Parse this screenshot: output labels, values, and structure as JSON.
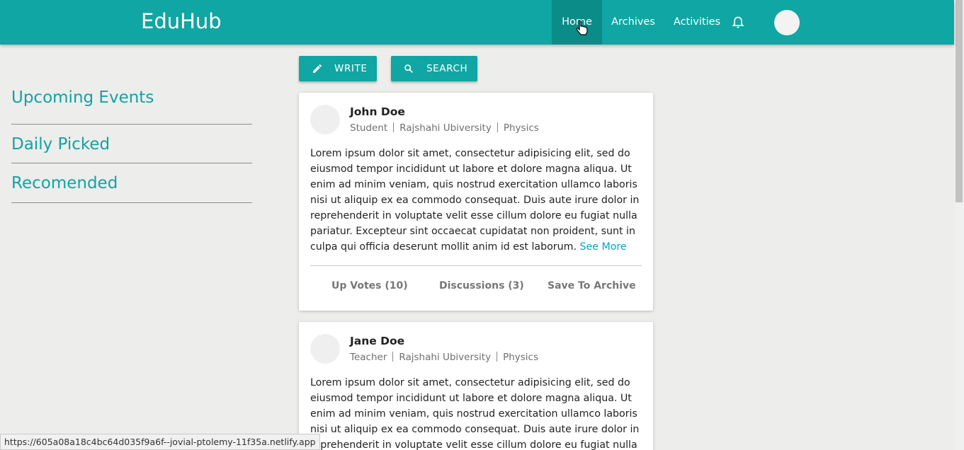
{
  "header": {
    "brand": "EduHub",
    "nav": [
      {
        "label": "Home"
      },
      {
        "label": "Archives"
      },
      {
        "label": "Activities"
      }
    ],
    "bell_icon": "bell-icon",
    "accent_color": "#0fa6a3"
  },
  "sidebar": {
    "items": [
      {
        "label": "Upcoming Events"
      },
      {
        "label": "Daily Picked"
      },
      {
        "label": "Recomended"
      }
    ]
  },
  "toolbar": {
    "write_label": "WRITE",
    "write_icon": "pencil-icon",
    "search_label": "SEARCH",
    "search_icon": "search-icon"
  },
  "posts": [
    {
      "author": "John Doe",
      "role": "Student",
      "institution": "Rajshahi Ubiversity",
      "subject": "Physics",
      "body": "Lorem ipsum dolor sit amet, consectetur adipisicing elit, sed do eiusmod tempor incididunt ut labore et dolore magna aliqua. Ut enim ad minim veniam, quis nostrud exercitation ullamco laboris nisi ut aliquip ex ea commodo consequat. Duis aute irure dolor in reprehenderit in voluptate velit esse cillum dolore eu fugiat nulla pariatur. Excepteur sint occaecat cupidatat non proident, sunt in culpa qui officia deserunt mollit anim id est laborum.",
      "see_more": "See More",
      "upvotes_label": "Up Votes (10)",
      "discussions_label": "Discussions (3)",
      "save_label": "Save To Archive"
    },
    {
      "author": "Jane Doe",
      "role": "Teacher",
      "institution": "Rajshahi Ubiversity",
      "subject": "Physics",
      "body": "Lorem ipsum dolor sit amet, consectetur adipisicing elit, sed do eiusmod tempor incididunt ut labore et dolore magna aliqua. Ut enim ad minim veniam, quis nostrud exercitation ullamco laboris nisi ut aliquip ex ea commodo consequat. Duis aute irure dolor in reprehenderit in voluptate velit esse cillum dolore eu fugiat nulla"
    }
  ],
  "status_bar": {
    "url": "https://605a08a18c4bc64d035f9a6f--jovial-ptolemy-11f35a.netlify.app"
  }
}
